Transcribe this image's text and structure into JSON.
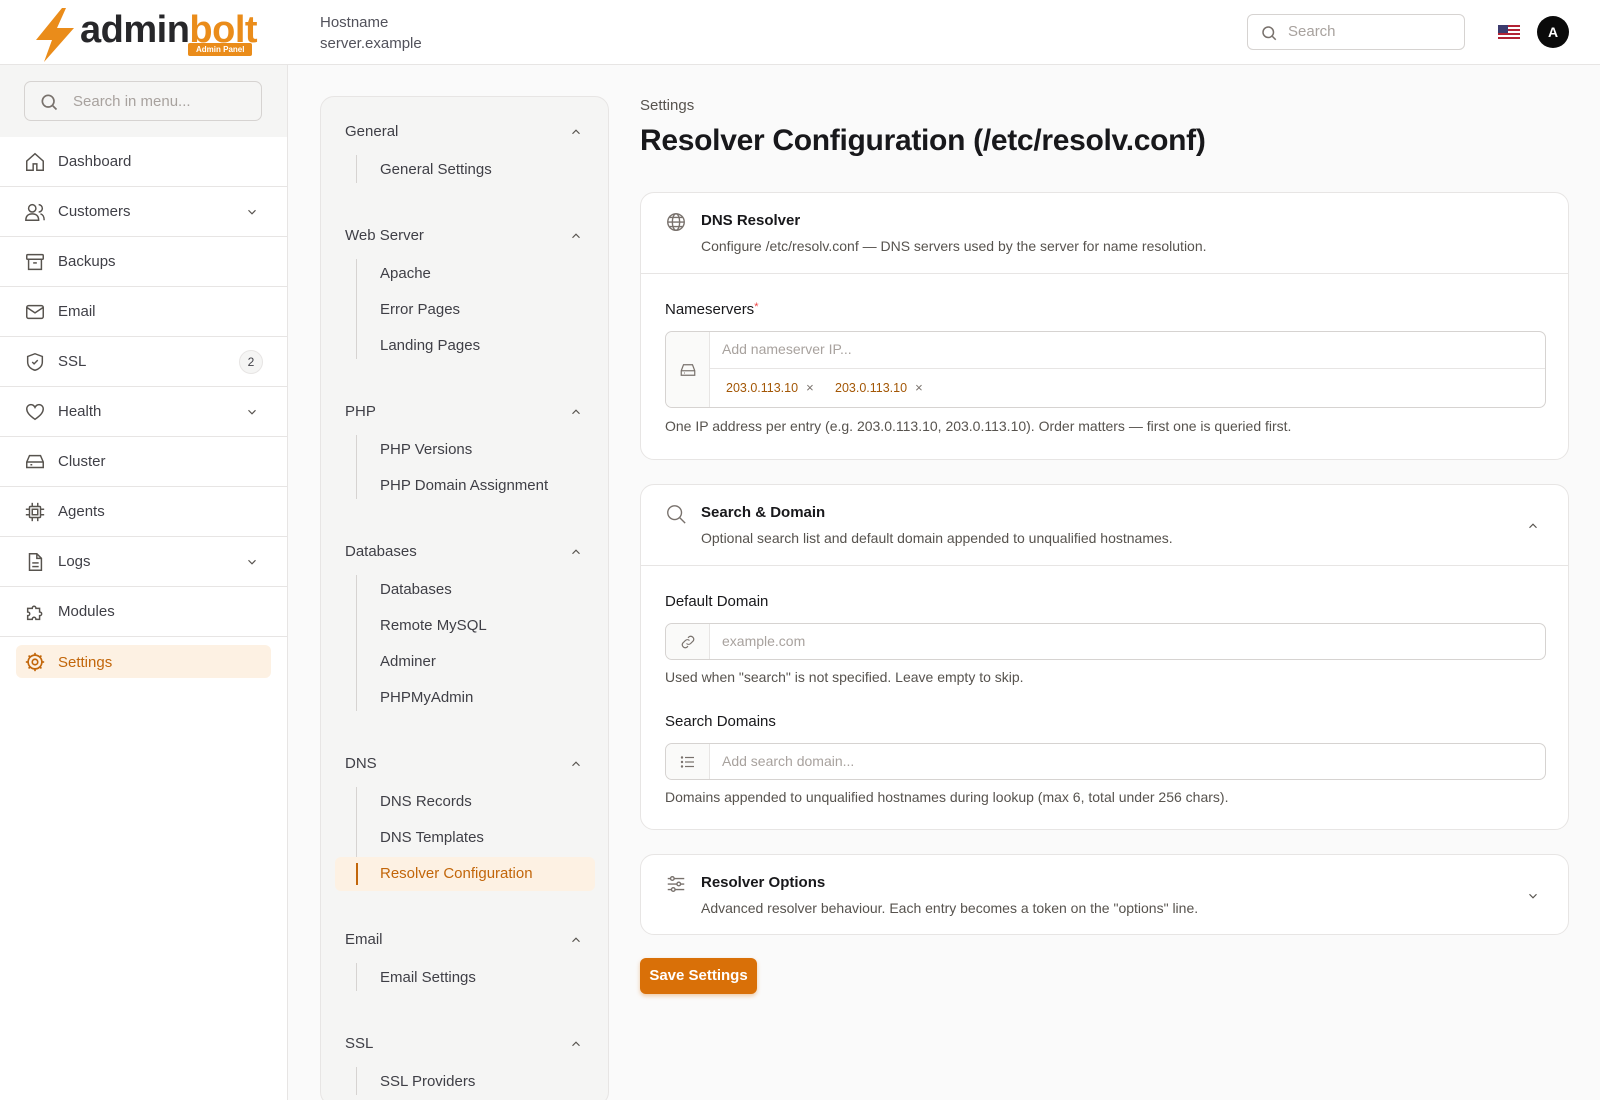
{
  "brand": {
    "name_part1": "admin",
    "name_part2": "bolt",
    "badge": "Admin Panel",
    "accent": "#ea8c1a"
  },
  "header": {
    "hostname_label": "Hostname",
    "hostname_value": "server.example",
    "search_placeholder": "Search",
    "avatar_initial": "A",
    "flag_icon": "us-flag-icon"
  },
  "sidebar": {
    "search_placeholder": "Search in menu...",
    "items": [
      {
        "label": "Dashboard",
        "icon": "home-icon"
      },
      {
        "label": "Customers",
        "icon": "users-icon",
        "expandable": true
      },
      {
        "label": "Backups",
        "icon": "archive-icon"
      },
      {
        "label": "Email",
        "icon": "mail-icon"
      },
      {
        "label": "SSL",
        "icon": "shield-check-icon",
        "badge": "2"
      },
      {
        "label": "Health",
        "icon": "heart-icon",
        "expandable": true
      },
      {
        "label": "Cluster",
        "icon": "server-icon"
      },
      {
        "label": "Agents",
        "icon": "cpu-icon"
      },
      {
        "label": "Logs",
        "icon": "file-text-icon",
        "expandable": true
      },
      {
        "label": "Modules",
        "icon": "puzzle-icon"
      },
      {
        "label": "Settings",
        "icon": "settings-icon",
        "active": true
      }
    ]
  },
  "subnav": {
    "groups": [
      {
        "title": "General",
        "items": [
          "General Settings"
        ]
      },
      {
        "title": "Web Server",
        "items": [
          "Apache",
          "Error Pages",
          "Landing Pages"
        ]
      },
      {
        "title": "PHP",
        "items": [
          "PHP Versions",
          "PHP Domain Assignment"
        ]
      },
      {
        "title": "Databases",
        "items": [
          "Databases",
          "Remote MySQL",
          "Adminer",
          "PHPMyAdmin"
        ]
      },
      {
        "title": "DNS",
        "items": [
          "DNS Records",
          "DNS Templates",
          "Resolver Configuration"
        ],
        "active_item": "Resolver Configuration"
      },
      {
        "title": "Email",
        "items": [
          "Email Settings"
        ]
      },
      {
        "title": "SSL",
        "items": [
          "SSL Providers"
        ]
      }
    ]
  },
  "page": {
    "breadcrumb": "Settings",
    "title": "Resolver Configuration (/etc/resolv.conf)",
    "save_label": "Save Settings"
  },
  "dns_resolver": {
    "title": "DNS Resolver",
    "description": "Configure /etc/resolv.conf — DNS servers used by the server for name resolution.",
    "nameservers_label": "Nameservers",
    "required_mark": "*",
    "nameservers_placeholder": "Add nameserver IP...",
    "nameservers": [
      "203.0.113.10",
      "203.0.113.10"
    ],
    "hint": "One IP address per entry (e.g. 203.0.113.10, 203.0.113.10). Order matters — first one is queried first."
  },
  "search_domain": {
    "title": "Search & Domain",
    "description": "Optional search list and default domain appended to unqualified hostnames.",
    "default_domain_label": "Default Domain",
    "default_domain_placeholder": "example.com",
    "default_domain_hint": "Used when \"search\" is not specified. Leave empty to skip.",
    "search_domains_label": "Search Domains",
    "search_domains_placeholder": "Add search domain...",
    "search_domains_hint": "Domains appended to unqualified hostnames during lookup (max 6, total under 256 chars)."
  },
  "resolver_options": {
    "title": "Resolver Options",
    "description": "Advanced resolver behaviour. Each entry becomes a token on the \"options\" line."
  },
  "tag_remove_glyph": "×"
}
